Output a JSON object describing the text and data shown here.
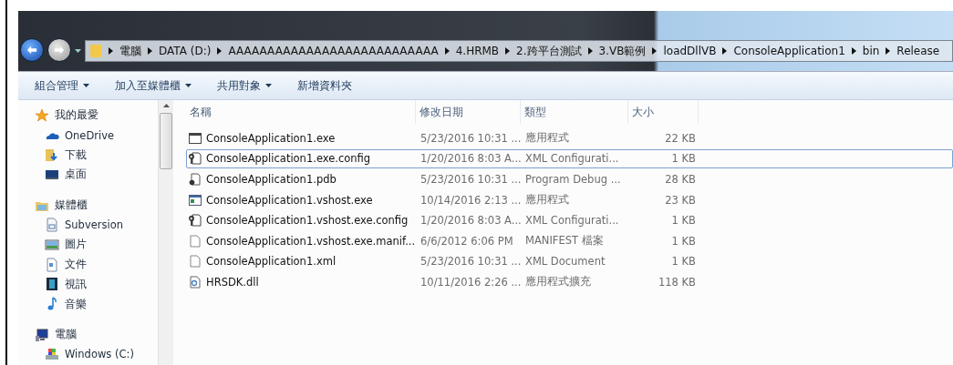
{
  "breadcrumb": [
    "電腦",
    "DATA (D:)",
    "AAAAAAAAAAAAAAAAAAAAAAAAAAA",
    "4.HRMB",
    "2.跨平台測試",
    "3.VB範例",
    "loadDllVB",
    "ConsoleApplication1",
    "bin",
    "Release"
  ],
  "toolbar": [
    {
      "label": "組合管理",
      "dropdown": true
    },
    {
      "label": "加入至媒體櫃",
      "dropdown": true
    },
    {
      "label": "共用對象",
      "dropdown": true
    },
    {
      "label": "新增資料夾",
      "dropdown": false
    }
  ],
  "sidebar": [
    {
      "label": "我的最愛",
      "kind": "favorites",
      "children": [
        {
          "label": "OneDrive",
          "kind": "cloud"
        },
        {
          "label": "下載",
          "kind": "download"
        },
        {
          "label": "桌面",
          "kind": "desktop"
        }
      ]
    },
    {
      "label": "媒體櫃",
      "kind": "library",
      "children": [
        {
          "label": "Subversion",
          "kind": "doc"
        },
        {
          "label": "圖片",
          "kind": "pictures"
        },
        {
          "label": "文件",
          "kind": "documents"
        },
        {
          "label": "視訊",
          "kind": "video"
        },
        {
          "label": "音樂",
          "kind": "music"
        }
      ]
    },
    {
      "label": "電腦",
      "kind": "computer",
      "children": [
        {
          "label": "Windows (C:)",
          "kind": "drive"
        }
      ]
    }
  ],
  "columns": [
    "名稱",
    "修改日期",
    "類型",
    "大小"
  ],
  "files": [
    {
      "name": "ConsoleApplication1.exe",
      "date": "5/23/2016 10:31 ...",
      "type": "應用程式",
      "size": "22 KB",
      "kind": "exe",
      "focused": false
    },
    {
      "name": "ConsoleApplication1.exe.config",
      "date": "1/20/2016 8:03 A...",
      "type": "XML Configurati...",
      "size": "1 KB",
      "kind": "config",
      "focused": true
    },
    {
      "name": "ConsoleApplication1.pdb",
      "date": "5/23/2016 10:31 ...",
      "type": "Program Debug ...",
      "size": "28 KB",
      "kind": "pdb",
      "focused": false
    },
    {
      "name": "ConsoleApplication1.vshost.exe",
      "date": "10/14/2016 2:13 ...",
      "type": "應用程式",
      "size": "23 KB",
      "kind": "vshost",
      "focused": false
    },
    {
      "name": "ConsoleApplication1.vshost.exe.config",
      "date": "1/20/2016 8:03 A...",
      "type": "XML Configurati...",
      "size": "1 KB",
      "kind": "config",
      "focused": false
    },
    {
      "name": "ConsoleApplication1.vshost.exe.manif...",
      "date": "6/6/2012 6:06 PM",
      "type": "MANIFEST 檔案",
      "size": "1 KB",
      "kind": "file",
      "focused": false
    },
    {
      "name": "ConsoleApplication1.xml",
      "date": "5/23/2016 10:31 ...",
      "type": "XML Document",
      "size": "1 KB",
      "kind": "file",
      "focused": false
    },
    {
      "name": "HRSDK.dll",
      "date": "10/11/2016 2:26 ...",
      "type": "應用程式擴充",
      "size": "118 KB",
      "kind": "dll",
      "focused": false
    }
  ]
}
